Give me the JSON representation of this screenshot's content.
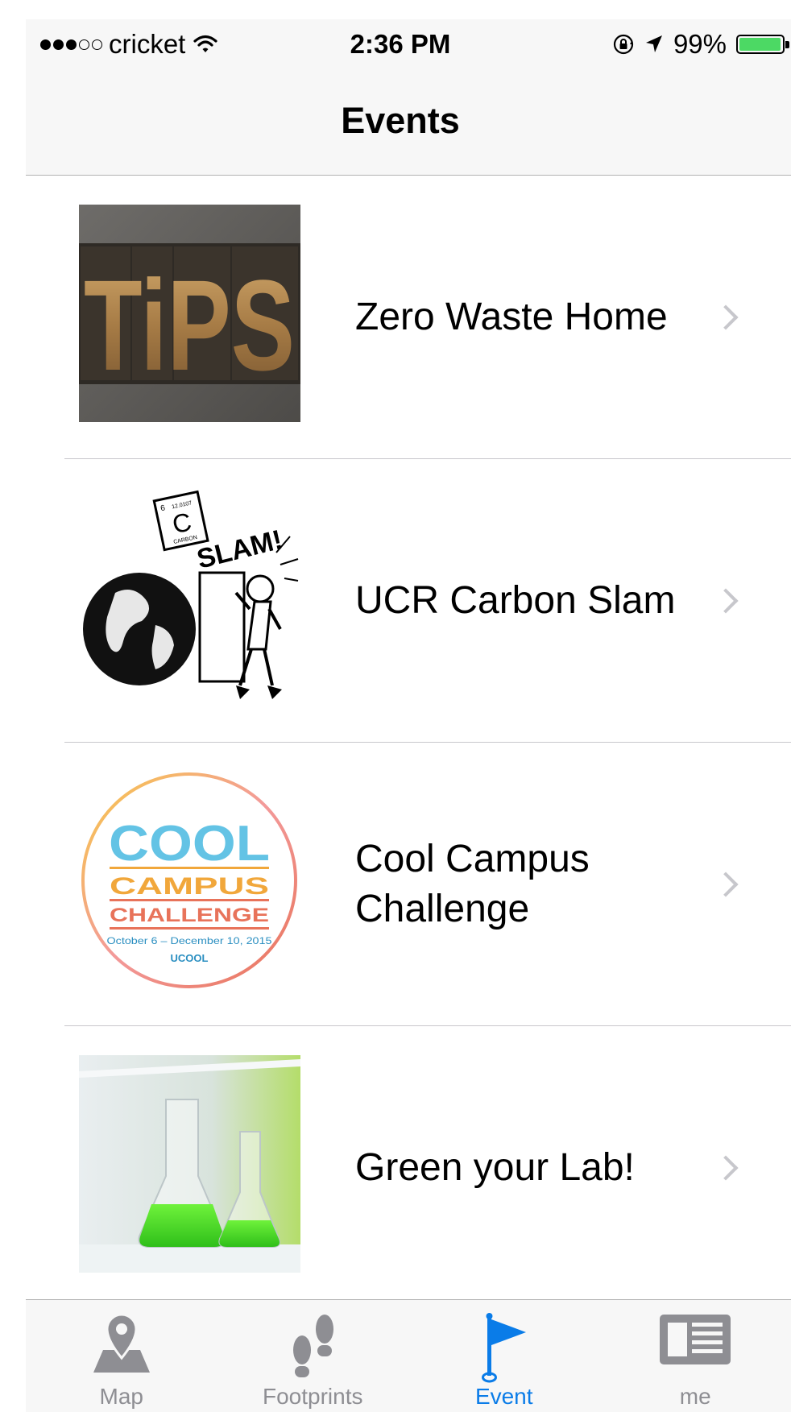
{
  "status_bar": {
    "carrier": "cricket",
    "time": "2:36 PM",
    "battery_percent": "99%",
    "battery_level": 0.99,
    "signal_bars_filled": 3,
    "signal_bars_total": 5
  },
  "nav": {
    "title": "Events"
  },
  "events": [
    {
      "title": "Zero Waste Home",
      "thumb_icon": "tips-letterpress-image",
      "thumb_text": "TiPS"
    },
    {
      "title": "UCR Carbon Slam",
      "thumb_icon": "carbon-slam-cartoon-image",
      "thumb_element_symbol": "C",
      "thumb_element_number": "6",
      "thumb_element_weight": "12.0107",
      "thumb_element_name": "CARBON",
      "thumb_slam_text": "SLAM!"
    },
    {
      "title": "Cool Campus Challenge",
      "title_line1": "Cool Campus",
      "title_line2": "Challenge",
      "thumb_icon": "cool-campus-challenge-logo",
      "logo_cool": "COOL",
      "logo_campus": "CAMPUS",
      "logo_challenge": "CHALLENGE",
      "logo_dates": "October 6 – December 10, 2015",
      "logo_brand": "UCOOL"
    },
    {
      "title": "Green your Lab!",
      "thumb_icon": "green-flask-lab-image"
    }
  ],
  "tabs": [
    {
      "label": "Map",
      "icon": "map-pin-icon",
      "active": false
    },
    {
      "label": "Footprints",
      "icon": "footprints-icon",
      "active": false
    },
    {
      "label": "Event",
      "icon": "flag-icon",
      "active": true
    },
    {
      "label": "me",
      "icon": "profile-card-icon",
      "active": false
    }
  ],
  "colors": {
    "tab_active": "#0a7ce8",
    "tab_inactive": "#8e8e93",
    "battery": "#4cd964",
    "chevron": "#c7c7cc",
    "separator": "#c8c7cc",
    "bar_background": "#f7f7f7"
  }
}
